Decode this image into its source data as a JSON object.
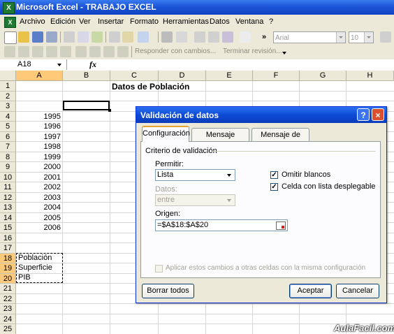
{
  "window": {
    "title": "Microsoft Excel - TRABAJO EXCEL",
    "app_icon": "excel-icon"
  },
  "menu": {
    "items": [
      "Archivo",
      "Edición",
      "Ver",
      "Insertar",
      "Formato",
      "Herramientas",
      "Datos",
      "Ventana",
      "?"
    ]
  },
  "toolbar": {
    "font_name": "Arial",
    "font_size": "10",
    "reply_label": "Responder con cambios...",
    "end_review_label": "Terminar revisión..."
  },
  "formula_bar": {
    "name_box": "A18",
    "fx_label": "fx",
    "content": ""
  },
  "sheet": {
    "columns": [
      "A",
      "B",
      "C",
      "D",
      "E",
      "F",
      "G",
      "H"
    ],
    "rows": [
      "1",
      "2",
      "3",
      "4",
      "5",
      "6",
      "7",
      "8",
      "9",
      "10",
      "11",
      "12",
      "13",
      "14",
      "15",
      "16",
      "17",
      "18",
      "19",
      "20",
      "21",
      "22",
      "23",
      "24",
      "25"
    ],
    "title_cell": "Datos de Población",
    "years": [
      "1995",
      "1996",
      "1997",
      "1998",
      "1999",
      "2000",
      "2001",
      "2002",
      "2003",
      "2004",
      "2005",
      "2006"
    ],
    "list_items": [
      "Población",
      "Superficie",
      "PIB"
    ]
  },
  "dialog": {
    "title": "Validación de datos",
    "tabs": [
      "Configuración",
      "Mensaje entrante",
      "Mensaje de error"
    ],
    "section_label": "Criterio de validación",
    "allow_label": "Permitir:",
    "allow_value": "Lista",
    "data_label": "Datos:",
    "data_value": "entre",
    "source_label": "Origen:",
    "source_value": "=$A$18:$A$20",
    "ignore_blank_label": "Omitir blancos",
    "ignore_blank_checked": true,
    "dropdown_label": "Celda con lista desplegable",
    "dropdown_checked": true,
    "apply_all_label": "Aplicar estos cambios a otras celdas con la misma configuración",
    "apply_all_checked": false,
    "clear_button": "Borrar todos",
    "ok_button": "Aceptar",
    "cancel_button": "Cancelar",
    "help_glyph": "?",
    "close_glyph": "×",
    "check_glyph": "✓"
  },
  "watermark": "AulaFacil.com",
  "colors": {
    "title_bar": "#0f43c2",
    "selected_header": "#ffc97a",
    "face": "#ece9d8"
  }
}
